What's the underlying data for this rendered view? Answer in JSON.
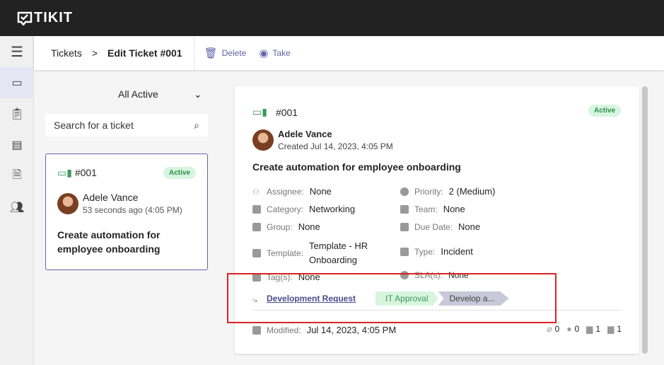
{
  "app": {
    "name": "TIKIT"
  },
  "header": {
    "breadcrumb_root": "Tickets",
    "breadcrumb_current": "Edit Ticket #001",
    "delete": "Delete",
    "take": "Take"
  },
  "list": {
    "filter": "All Active",
    "search_placeholder": "Search for a ticket",
    "card": {
      "id": "#001",
      "status": "Active",
      "requester": "Adele Vance",
      "time": "53 seconds ago (4:05 PM)",
      "title": "Create automation for employee onboarding"
    }
  },
  "ticket": {
    "id": "#001",
    "status": "Active",
    "requester": "Adele Vance",
    "created": "Created Jul 14, 2023, 4:05 PM",
    "title": "Create automation for employee onboarding",
    "fields": {
      "assignee_label": "Assignee:",
      "assignee": "None",
      "priority_label": "Priority:",
      "priority": "2 (Medium)",
      "category_label": "Category:",
      "category": "Networking",
      "team_label": "Team:",
      "team": "None",
      "group_label": "Group:",
      "group": "None",
      "due_label": "Due Date:",
      "due": "None",
      "template_label": "Template:",
      "template": "Template - HR Onboarding",
      "type_label": "Type:",
      "type": "Incident",
      "tags_label": "Tag(s):",
      "tags": "None",
      "sla_label": "SLA(s):",
      "sla": "None"
    },
    "lifecycle": {
      "name": "Development Request",
      "phases": [
        "IT Approval",
        "Develop a..."
      ]
    },
    "modified_label": "Modified:",
    "modified": "Jul 14, 2023, 4:05 PM",
    "counts": {
      "attachments": "0",
      "comments": "0",
      "requests": "1",
      "conversations": "1"
    }
  },
  "colors": {
    "accent": "#6264a7",
    "active": "#d7f5df"
  }
}
